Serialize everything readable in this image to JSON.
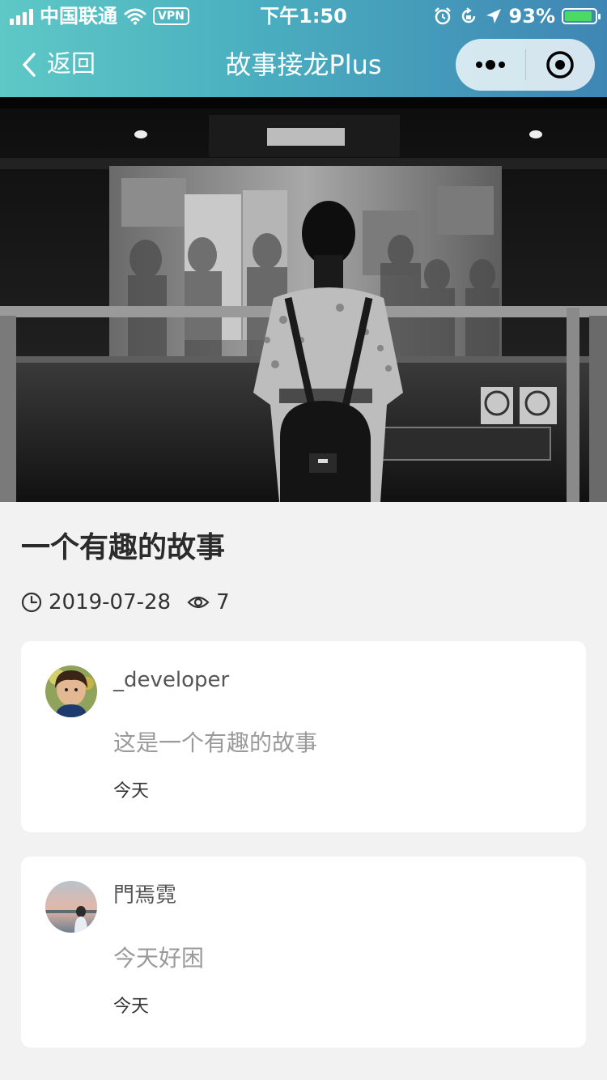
{
  "status_bar": {
    "carrier": "中国联通",
    "vpn": "VPN",
    "time": "下午1:50",
    "battery": "93%",
    "battery_level": 0.93
  },
  "navbar": {
    "back_label": "返回",
    "title": "故事接龙Plus"
  },
  "story": {
    "title": "一个有趣的故事",
    "date": "2019-07-28",
    "views": "7"
  },
  "comments": [
    {
      "user": "_developer",
      "text": "这是一个有趣的故事",
      "time": "今天"
    },
    {
      "user": "門焉霓",
      "text": "今天好困",
      "time": "今天"
    }
  ],
  "colors": {
    "header_gradient_start": "#5ec8c6",
    "header_gradient_end": "#3f86b4",
    "page_background": "#f2f2f2",
    "card_background": "#ffffff"
  }
}
